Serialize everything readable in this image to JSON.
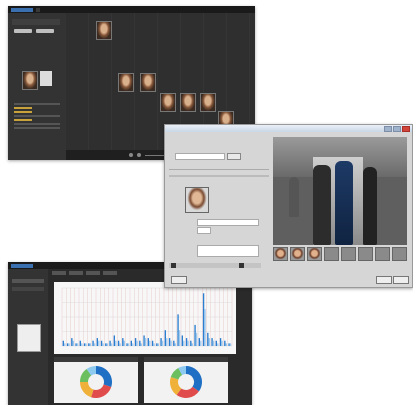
{
  "window_viewer": {
    "tabs": [
      "",
      "",
      ""
    ],
    "faces_count": 7
  },
  "window_dialog": {
    "search_button": "",
    "video_people": 4,
    "ok_button": "",
    "cancel_button": ""
  },
  "window_dashboard": {
    "tabs": [
      "",
      "",
      "",
      ""
    ],
    "chart_data": {
      "type": "bar",
      "title": "",
      "xlabel": "",
      "ylabel": "",
      "categories": [
        "1",
        "2",
        "3",
        "4",
        "5",
        "6",
        "7",
        "8",
        "9",
        "10",
        "11",
        "12",
        "13",
        "14",
        "15",
        "16",
        "17",
        "18",
        "19",
        "20",
        "21",
        "22",
        "23",
        "24",
        "25",
        "26",
        "27",
        "28",
        "29",
        "30",
        "31",
        "32",
        "33",
        "34",
        "35",
        "36",
        "37",
        "38",
        "39",
        "40"
      ],
      "series": [
        {
          "values": [
            2,
            1,
            3,
            1,
            2,
            1,
            1,
            2,
            3,
            2,
            1,
            2,
            4,
            2,
            3,
            1,
            2,
            3,
            2,
            4,
            3,
            2,
            1,
            3,
            6,
            3,
            2,
            12,
            4,
            3,
            2,
            8,
            3,
            20,
            5,
            3,
            2,
            3,
            2,
            1
          ]
        },
        {
          "values": [
            1,
            1,
            2,
            1,
            1,
            1,
            1,
            1,
            2,
            1,
            1,
            1,
            2,
            1,
            2,
            1,
            1,
            2,
            1,
            3,
            2,
            1,
            1,
            2,
            3,
            2,
            1,
            6,
            2,
            2,
            1,
            5,
            2,
            14,
            3,
            2,
            1,
            2,
            1,
            1
          ]
        }
      ],
      "ylim": [
        0,
        22
      ],
      "grid": true
    },
    "donuts": [
      {
        "values": [
          30,
          25,
          20,
          15,
          10
        ],
        "colors": [
          "#1f6fc4",
          "#e04b4b",
          "#f0b13a",
          "#6cbf5e",
          "#8ec9f0"
        ]
      },
      {
        "values": [
          35,
          25,
          20,
          12,
          8
        ],
        "colors": [
          "#1f6fc4",
          "#e04b4b",
          "#f0b13a",
          "#6cbf5e",
          "#8ec9f0"
        ]
      }
    ]
  }
}
